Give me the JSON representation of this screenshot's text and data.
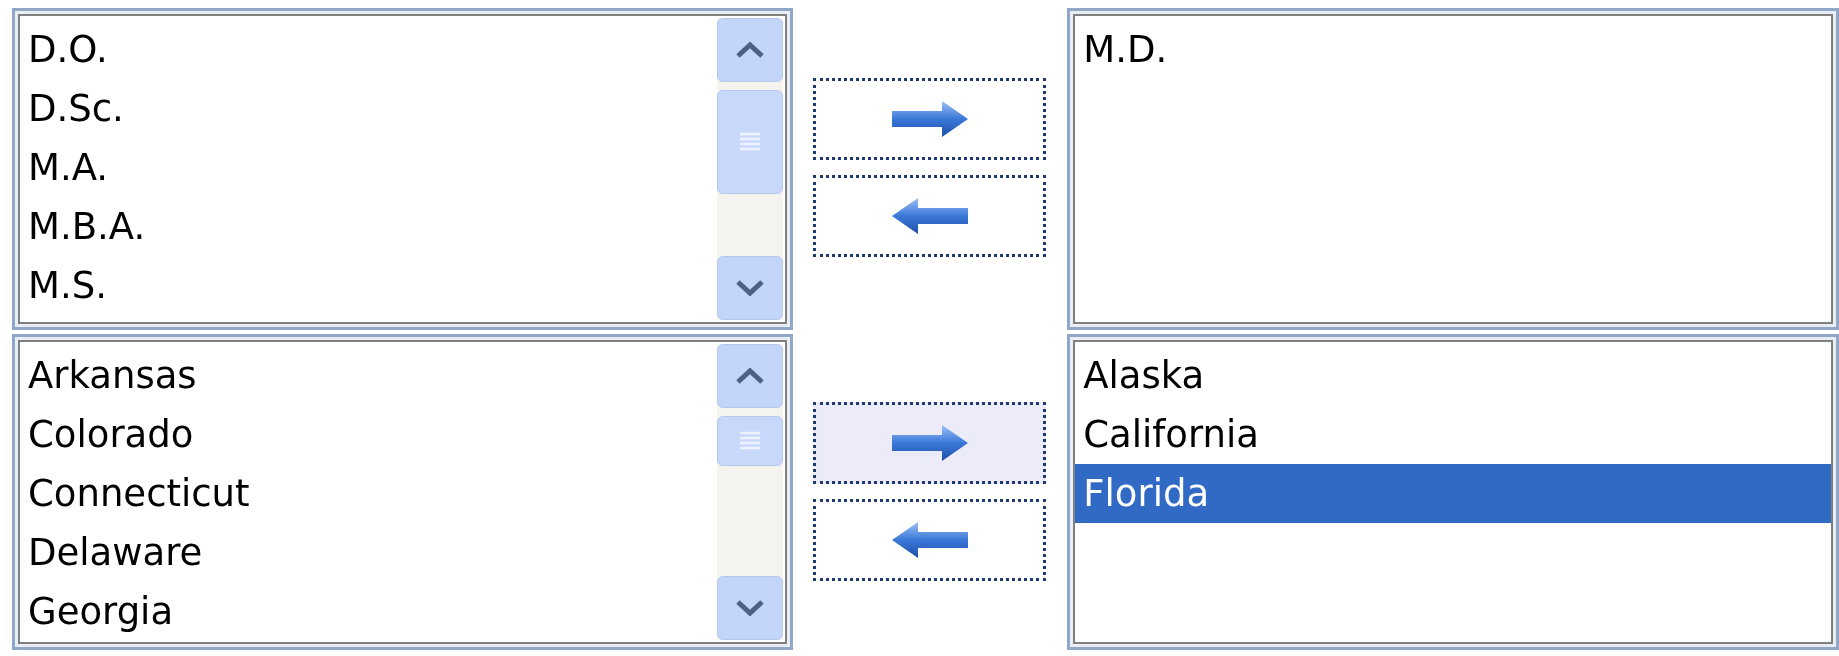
{
  "pairs": [
    {
      "available": {
        "items": [
          {
            "label": "D.O.",
            "selected": false
          },
          {
            "label": "D.Sc.",
            "selected": false
          },
          {
            "label": "M.A.",
            "selected": false
          },
          {
            "label": "M.B.A.",
            "selected": false
          },
          {
            "label": "M.S.",
            "selected": false
          }
        ]
      },
      "buttons": [
        {
          "kind": "move-right",
          "hovered": false
        },
        {
          "kind": "move-left",
          "hovered": false
        }
      ],
      "chosen": {
        "items": [
          {
            "label": "M.D.",
            "selected": false
          }
        ]
      }
    },
    {
      "available": {
        "items": [
          {
            "label": "Arkansas",
            "selected": false
          },
          {
            "label": "Colorado",
            "selected": false
          },
          {
            "label": "Connecticut",
            "selected": false
          },
          {
            "label": "Delaware",
            "selected": false
          },
          {
            "label": "Georgia",
            "selected": false
          }
        ]
      },
      "buttons": [
        {
          "kind": "move-right",
          "hovered": true
        },
        {
          "kind": "move-left",
          "hovered": false
        }
      ],
      "chosen": {
        "items": [
          {
            "label": "Alaska",
            "selected": false
          },
          {
            "label": "California",
            "selected": false
          },
          {
            "label": "Florida",
            "selected": true
          }
        ]
      }
    }
  ]
}
